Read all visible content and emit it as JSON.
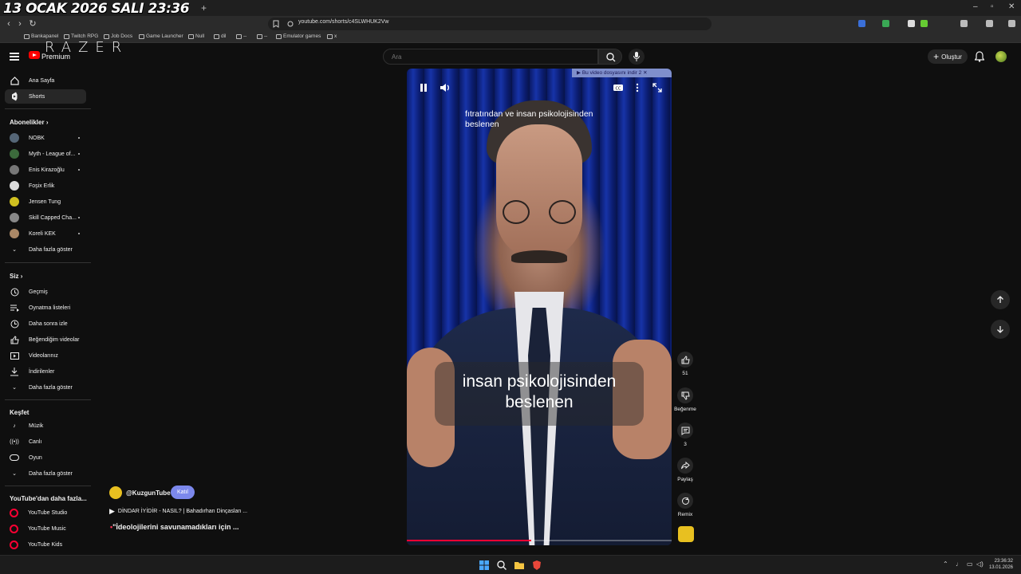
{
  "overlay": {
    "clock": "13 OCAK 2026 SALI 23:36",
    "brand": "RAZER"
  },
  "browser": {
    "url": "youtube.com/shorts/c4SLWHUK2Vw",
    "bookmarks": [
      "Bankapanel",
      "Twitch RPG",
      "Job Docs",
      "Game Launcher",
      "Null",
      "dil",
      "--",
      "--",
      "Emulator games",
      "x"
    ]
  },
  "header": {
    "premium_label": "Premium",
    "search_placeholder": "Ara",
    "create_label": "Oluştur"
  },
  "sidebar": {
    "main": [
      {
        "label": "Ana Sayfa",
        "icon": "home-icon"
      },
      {
        "label": "Shorts",
        "icon": "shorts-icon"
      }
    ],
    "subs_title": "Abonelikler",
    "subs": [
      {
        "label": "NOBK",
        "color": "#556677"
      },
      {
        "label": "Myth - League of...",
        "color": "#3c6a3c"
      },
      {
        "label": "Enis Kirazoğlu",
        "color": "#777777"
      },
      {
        "label": "Foşix Erlik",
        "color": "#dddddd"
      },
      {
        "label": "Jensen Tung",
        "color": "#d0c020"
      },
      {
        "label": "Skill Capped Cha...",
        "color": "#888888"
      },
      {
        "label": "Koreli KEK",
        "color": "#aa8866"
      }
    ],
    "subs_more": "Daha fazla göster",
    "you_title": "Siz",
    "you": [
      {
        "label": "Geçmiş",
        "icon": "history-icon"
      },
      {
        "label": "Oynatma listeleri",
        "icon": "playlist-icon"
      },
      {
        "label": "Daha sonra izle",
        "icon": "clock-icon"
      },
      {
        "label": "Beğendiğim videolar",
        "icon": "thumbs-up-icon"
      },
      {
        "label": "Videolarınız",
        "icon": "video-icon"
      },
      {
        "label": "İndirilenler",
        "icon": "download-icon"
      },
      {
        "label": "Daha fazla göster",
        "icon": "chevron-down-icon"
      }
    ],
    "explore_title": "Keşfet",
    "explore": [
      {
        "label": "Müzik",
        "icon": "music-icon"
      },
      {
        "label": "Canlı",
        "icon": "live-icon"
      },
      {
        "label": "Oyun",
        "icon": "gaming-icon"
      },
      {
        "label": "Daha fazla göster",
        "icon": "chevron-down-icon"
      }
    ],
    "more_title": "YouTube'dan daha fazla...",
    "more": [
      {
        "label": "YouTube Studio"
      },
      {
        "label": "YouTube Music"
      },
      {
        "label": "YouTube Kids"
      }
    ]
  },
  "video": {
    "caption_top": "fıtratından ve insan psikolojisinden beslenen",
    "caption_main": "insan psikolojisinden beslenen",
    "ad_banner": "Bu video dosyasını indir",
    "ad_count": "2",
    "progress": 0.47
  },
  "actions": {
    "like_count": "51",
    "dislike_label": "Beğenme",
    "comment_count": "3",
    "share_label": "Paylaş",
    "remix_label": "Remix"
  },
  "channel": {
    "handle": "@KuzgunTube",
    "join_label": "Katıl",
    "related_video": "DİNDAR İYİDİR - NASIL? | Bahadırhan Dinçaslan ...",
    "title": "\"İdeolojilerini savunamadıkları için ..."
  },
  "taskbar": {
    "time": "23:36:32",
    "date": "13.01.2026"
  }
}
